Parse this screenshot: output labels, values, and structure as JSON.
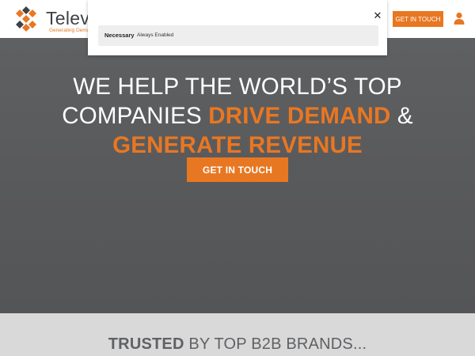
{
  "header": {
    "logo_name": "Telev",
    "logo_tagline": "Generating Dema",
    "cta_label": "GET IN TOUCH",
    "user_icon": "user-icon",
    "brand_color": "#e87722"
  },
  "hero": {
    "line1": "WE HELP THE WORLD’S TOP",
    "line2_plain": "COMPANIES",
    "line2_accent": "DRIVE DEMAND",
    "line2_end": "&",
    "line3_accent": "GENERATE REVENUE",
    "cta_label": "GET IN TOUCH"
  },
  "trusted": {
    "bold": "TRUSTED",
    "rest": "BY TOP B2B BRANDS..."
  },
  "consent": {
    "close_icon": "close-icon",
    "category_name": "Necessary",
    "category_state": "Always Enabled"
  }
}
